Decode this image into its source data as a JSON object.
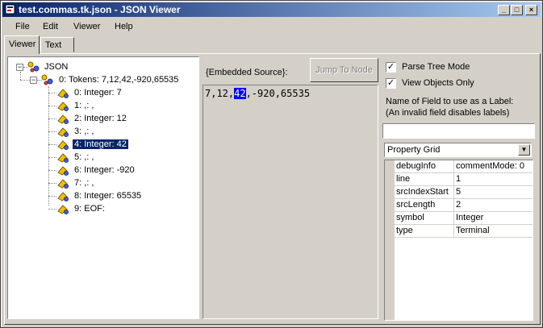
{
  "window": {
    "title": "test.commas.tk.json - JSON Viewer"
  },
  "titlebar_buttons": {
    "minimize": "_",
    "maximize": "□",
    "close": "×"
  },
  "menu": [
    "File",
    "Edit",
    "Viewer",
    "Help"
  ],
  "tabs": [
    "Viewer",
    "Text"
  ],
  "tree": {
    "root": "JSON",
    "tokens": "0: Tokens: 7,12,42,-920,65535",
    "children": [
      "0: Integer: 7",
      "1: ,: ,",
      "2: Integer: 12",
      "3: ,: ,",
      "4: Integer: 42",
      "5: ,: ,",
      "6: Integer: -920",
      "7: ,: ,",
      "8: Integer: 65535",
      "9: EOF:"
    ],
    "selected_index": 4
  },
  "source": {
    "label": "{Embedded Source}:",
    "jump_button": "Jump To Node",
    "before": "7,12,",
    "highlight": "42",
    "after": ",-920,65535"
  },
  "options": {
    "parse_tree_mode": {
      "label": "Parse Tree Mode",
      "checked": true
    },
    "view_objects_only": {
      "label": "View Objects Only",
      "checked": true
    },
    "field_label_line1": "Name of Field to use as a Label:",
    "field_label_line2": "(An invalid field disables labels)",
    "field_value": "",
    "view_select": "Property Grid"
  },
  "properties": [
    {
      "name": "debugInfo",
      "value": "commentMode: 0"
    },
    {
      "name": "line",
      "value": "1"
    },
    {
      "name": "srcIndexStart",
      "value": "5"
    },
    {
      "name": "srcLength",
      "value": "2"
    },
    {
      "name": "symbol",
      "value": "Integer"
    },
    {
      "name": "type",
      "value": "Terminal"
    }
  ]
}
